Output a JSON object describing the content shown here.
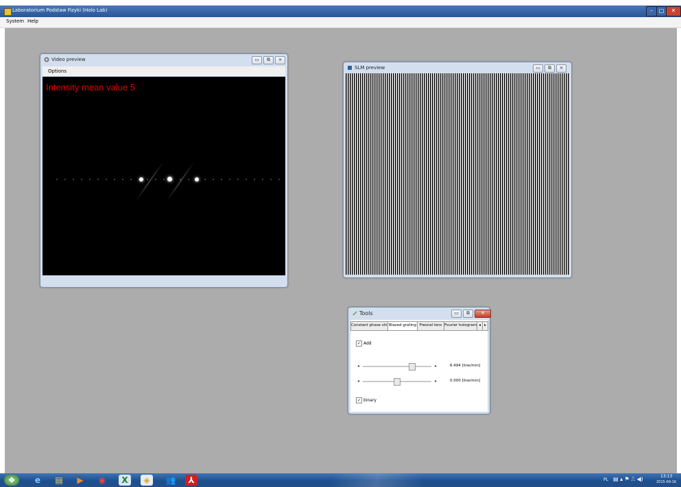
{
  "app": {
    "title": "Laboratorium Podstaw Fizyki (Holo Lab)",
    "menu": [
      "System",
      "Help"
    ],
    "caption_buttons": [
      "–",
      "□",
      "✕"
    ]
  },
  "video_window": {
    "title": "Video preview",
    "menu_label": "Options",
    "overlay_text": "Intensity mean value 5",
    "overlay_color": "#e60000"
  },
  "slm_window": {
    "title": "SLM preview"
  },
  "tools_window": {
    "title": "Tools",
    "tabs": [
      "Constant phase shift",
      "Blazed grating",
      "Fresnel lens",
      "Fourier hologram"
    ],
    "active_tab": "Blazed grating",
    "add_label": "Add",
    "add_checked": true,
    "slider1_value": "6.494 [line/mm]",
    "slider1_fraction": 0.72,
    "slider2_value": "0.000 [line/mm]",
    "slider2_fraction": 0.5,
    "binary_label": "binary",
    "binary_checked": true
  },
  "taskbar": {
    "language": "PL",
    "time": "13:13",
    "date": "2015-09-16",
    "icons": [
      "start-orb-icon",
      "internet-explorer-icon",
      "file-explorer-icon",
      "media-player-icon",
      "chrome-icon",
      "excel-icon",
      "app-icon",
      "users-icon",
      "acrobat-icon"
    ]
  }
}
